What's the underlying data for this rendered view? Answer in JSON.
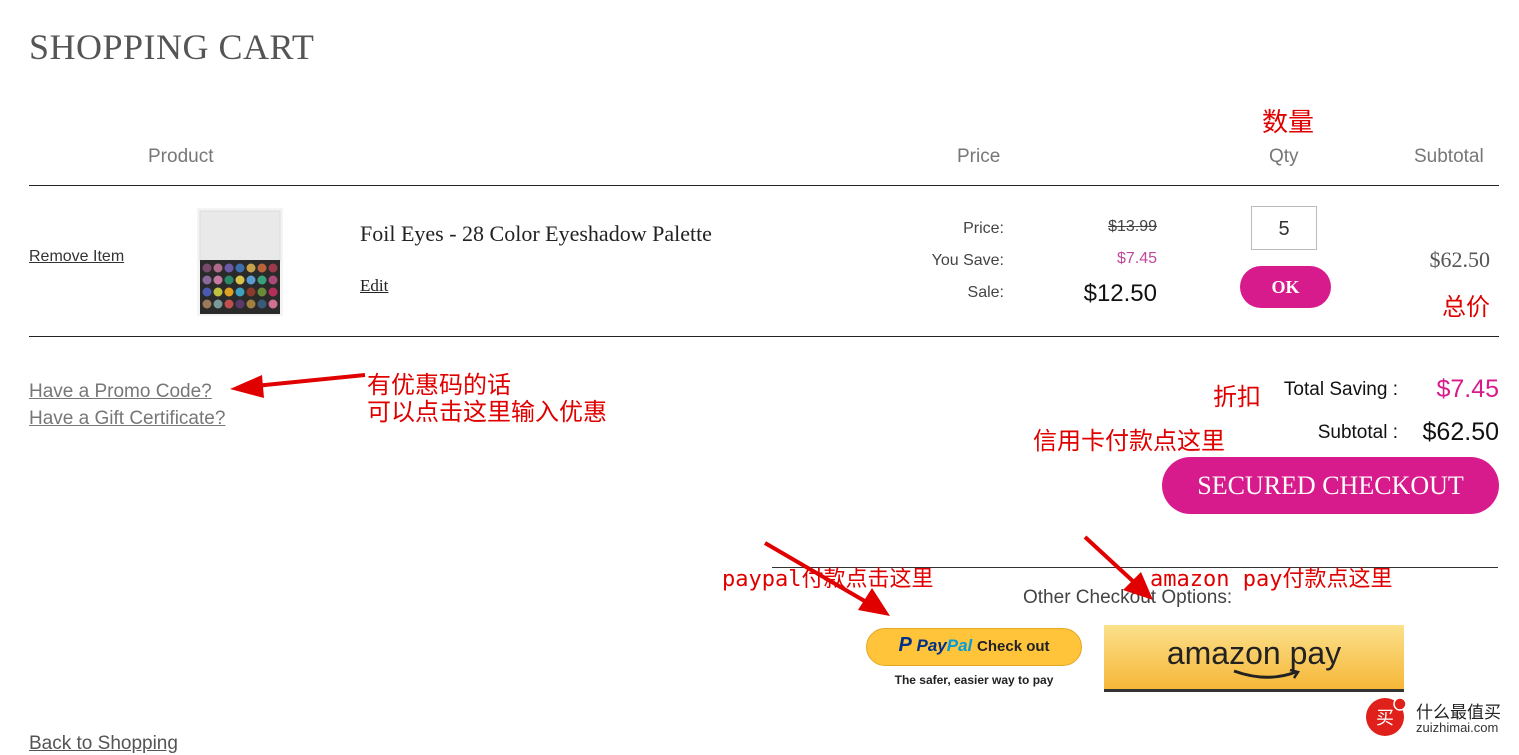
{
  "page": {
    "title": "SHOPPING CART"
  },
  "table_headers": {
    "product": "Product",
    "price": "Price",
    "qty": "Qty",
    "subtotal": "Subtotal"
  },
  "cart_item": {
    "remove_label": "Remove Item",
    "thumbnail_icon": "eyeshadow-palette-image",
    "name": "Foil Eyes - 28 Color Eyeshadow Palette",
    "edit_label": "Edit",
    "price_label": "Price:",
    "price_original": "$13.99",
    "save_label": "You Save:",
    "save_value": "$7.45",
    "sale_label": "Sale:",
    "sale_value": "$12.50",
    "qty_value": "5",
    "ok_label": "OK",
    "subtotal": "$62.50"
  },
  "links": {
    "promo": "Have a Promo Code?",
    "gift": "Have a Gift Certificate?"
  },
  "totals": {
    "saving_label": "Total Saving :",
    "saving_value": "$7.45",
    "subtotal_label": "Subtotal :",
    "subtotal_value": "$62.50"
  },
  "checkout": {
    "secured_label": "SECURED CHECKOUT",
    "other_options": "Other Checkout Options:",
    "paypal_brand_1": "Pay",
    "paypal_brand_2": "Pal",
    "paypal_button": "Check out",
    "paypal_tagline": "The safer, easier way to pay",
    "amazon_label": "amazon pay"
  },
  "footer": {
    "back_link": "Back to Shopping"
  },
  "annotations": {
    "qty": "数量",
    "total": "总价",
    "promo_1": "有优惠码的话",
    "promo_2": "可以点击这里输入优惠",
    "discount": "折扣",
    "credit_card": "信用卡付款点这里",
    "paypal": "paypal付款点击这里",
    "amazon": "amazon pay付款点这里"
  },
  "watermark": {
    "name": "什么最值买",
    "domain": "zuizhimai.com"
  },
  "colors": {
    "accent": "#d81b8c",
    "annotation": "#e00000",
    "paypal_yellow": "#ffc439",
    "amazon_gold": "#f6b738"
  }
}
